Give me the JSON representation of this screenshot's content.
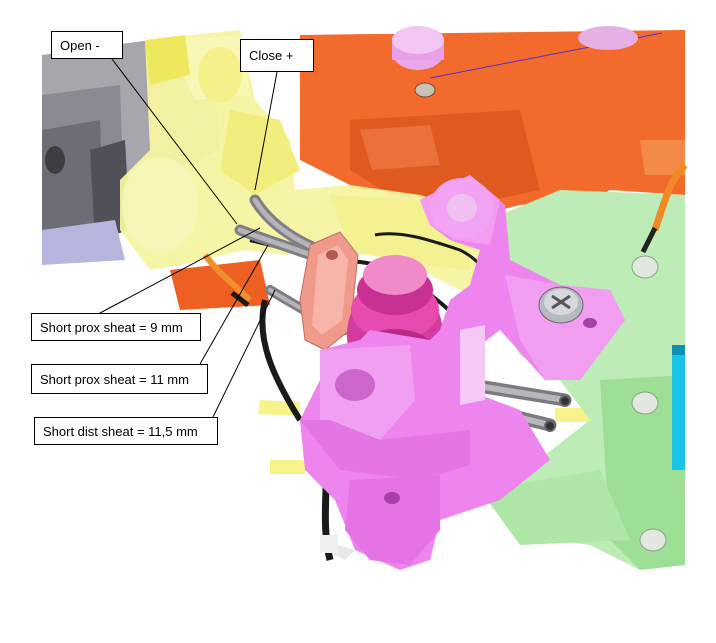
{
  "callouts": {
    "open": "Open -",
    "close": "Close +",
    "short_prox_9": "Short prox sheat = 9 mm",
    "short_prox_11": "Short prox sheat = 11  mm",
    "short_dist_115": "Short dist sheat = 11,5  mm"
  },
  "colors": {
    "orange_block": "#f06a2e",
    "yellow_part": "#f7f59a",
    "pink_part": "#ee82ee",
    "green_block": "#b8ecb0",
    "grey_tool": "#9b9ba3",
    "tube_grey": "#8c8c8c",
    "salmon_part": "#f29a8e"
  },
  "icons": {
    "scene": "cad-3d-assembly-illustration"
  }
}
